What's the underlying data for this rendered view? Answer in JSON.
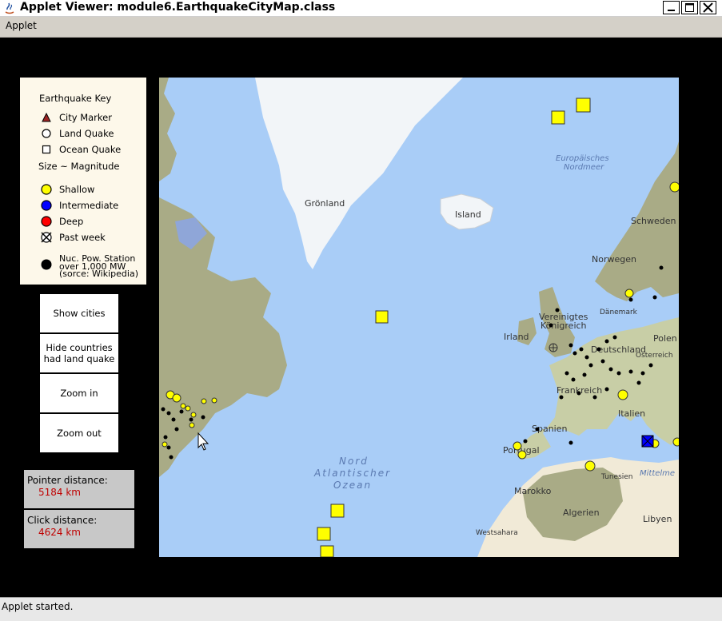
{
  "window": {
    "title": "Applet Viewer: module6.EarthquakeCityMap.class"
  },
  "menu": {
    "applet_label": "Applet"
  },
  "key": {
    "title": "Earthquake Key",
    "city_marker": "City Marker",
    "land_quake": "Land Quake",
    "ocean_quake": "Ocean Quake",
    "size_note": "Size ~ Magnitude",
    "shallow": "Shallow",
    "intermediate": "Intermediate",
    "deep": "Deep",
    "past_week": "Past week",
    "nuc_line1": "Nuc. Pow. Station",
    "nuc_line2": "over 1,000 MW",
    "nuc_line3": "(sorce: Wikipedia)",
    "colors": {
      "city": "#9c2424",
      "shallow": "#ffff00",
      "intermediate": "#0000ff",
      "deep": "#ff0000",
      "nuclear": "#000000"
    }
  },
  "controls": {
    "show_cities": "Show cities",
    "hide_countries_line1": "Hide countries",
    "hide_countries_line2": "had land quake",
    "zoom_in": "Zoom in",
    "zoom_out": "Zoom out"
  },
  "distance": {
    "pointer_label": "Pointer distance:",
    "pointer_value": "5184 km",
    "click_label": "Click distance:",
    "click_value": "4624 km"
  },
  "map": {
    "labels": {
      "greenland": "Grönland",
      "iceland": "Island",
      "europ_sea_line1": "Europäisches",
      "europ_sea_line2": "Nordmeer",
      "sweden": "Schweden",
      "norway": "Norwegen",
      "denmark": "Dänemark",
      "uk_line1": "Vereinigtes",
      "uk_line2": "Königreich",
      "ireland": "Irland",
      "germany": "Deutschland",
      "poland": "Polen",
      "france": "Frankreich",
      "italy": "Italien",
      "spain": "Spanien",
      "portugal": "Portugal",
      "ocean_line1": "Nord",
      "ocean_line2": "Atlantischer",
      "ocean_line3": "Ozean",
      "morocco": "Marokko",
      "algeria": "Algerien",
      "tunisia": "Tunesien",
      "libya": "Libyen",
      "mediterranean": "Mittelme",
      "western_sahara": "Westsahara",
      "austria": "Österreich"
    },
    "colors": {
      "ocean": "#a9cdf7",
      "ice": "#f2f5f8",
      "land": "#a9ab86",
      "land_light": "#c8cea6",
      "desert": "#f1ead7"
    }
  },
  "status": {
    "text": "Applet started."
  }
}
